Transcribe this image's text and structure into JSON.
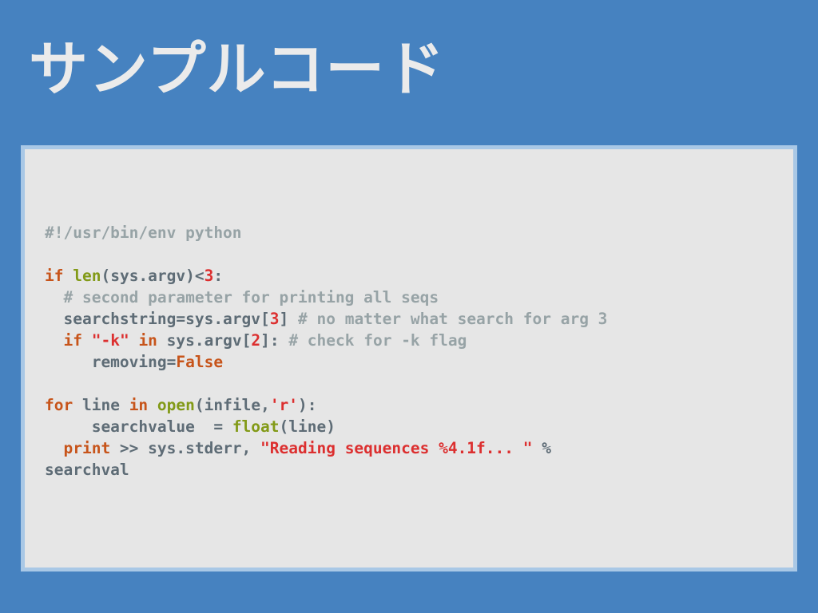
{
  "slide": {
    "title": "サンプルコード"
  },
  "code": {
    "language": "python",
    "colors": {
      "comment": "#97a3a6",
      "keyword": "#c7541a",
      "builtin": "#829a17",
      "number": "#dc2f2f",
      "string": "#dc2f2f",
      "plain": "#5e6c76"
    },
    "lines": [
      [
        {
          "t": "#!/usr/bin/env python",
          "c": "comment"
        }
      ],
      [],
      [
        {
          "t": "if",
          "c": "kw"
        },
        {
          "t": " ",
          "c": "plain"
        },
        {
          "t": "len",
          "c": "fn"
        },
        {
          "t": "(sys.argv)<",
          "c": "plain"
        },
        {
          "t": "3",
          "c": "num"
        },
        {
          "t": ":",
          "c": "plain"
        }
      ],
      [
        {
          "t": "  ",
          "c": "plain"
        },
        {
          "t": "# second parameter for printing all seqs",
          "c": "comment"
        }
      ],
      [
        {
          "t": "  searchstring=sys.argv[",
          "c": "plain"
        },
        {
          "t": "3",
          "c": "num"
        },
        {
          "t": "] ",
          "c": "plain"
        },
        {
          "t": "# no matter what search for arg 3",
          "c": "comment"
        }
      ],
      [
        {
          "t": "  ",
          "c": "plain"
        },
        {
          "t": "if",
          "c": "kw"
        },
        {
          "t": " ",
          "c": "plain"
        },
        {
          "t": "\"-k\"",
          "c": "str"
        },
        {
          "t": " ",
          "c": "plain"
        },
        {
          "t": "in",
          "c": "kw"
        },
        {
          "t": " sys.argv[",
          "c": "plain"
        },
        {
          "t": "2",
          "c": "num"
        },
        {
          "t": "]: ",
          "c": "plain"
        },
        {
          "t": "# check for -k flag",
          "c": "comment"
        }
      ],
      [
        {
          "t": "     removing=",
          "c": "plain"
        },
        {
          "t": "False",
          "c": "kw"
        }
      ],
      [],
      [
        {
          "t": "for",
          "c": "kw"
        },
        {
          "t": " line ",
          "c": "plain"
        },
        {
          "t": "in",
          "c": "kw"
        },
        {
          "t": " ",
          "c": "plain"
        },
        {
          "t": "open",
          "c": "fn"
        },
        {
          "t": "(infile,",
          "c": "plain"
        },
        {
          "t": "'r'",
          "c": "str"
        },
        {
          "t": "):",
          "c": "plain"
        }
      ],
      [
        {
          "t": "     searchvalue  = ",
          "c": "plain"
        },
        {
          "t": "float",
          "c": "fn"
        },
        {
          "t": "(line)",
          "c": "plain"
        }
      ],
      [
        {
          "t": "  ",
          "c": "plain"
        },
        {
          "t": "print",
          "c": "kw"
        },
        {
          "t": " >> sys.stderr, ",
          "c": "plain"
        },
        {
          "t": "\"Reading sequences %4.1f... \"",
          "c": "str"
        },
        {
          "t": " %",
          "c": "plain"
        }
      ],
      [
        {
          "t": "searchval",
          "c": "plain"
        }
      ]
    ]
  }
}
